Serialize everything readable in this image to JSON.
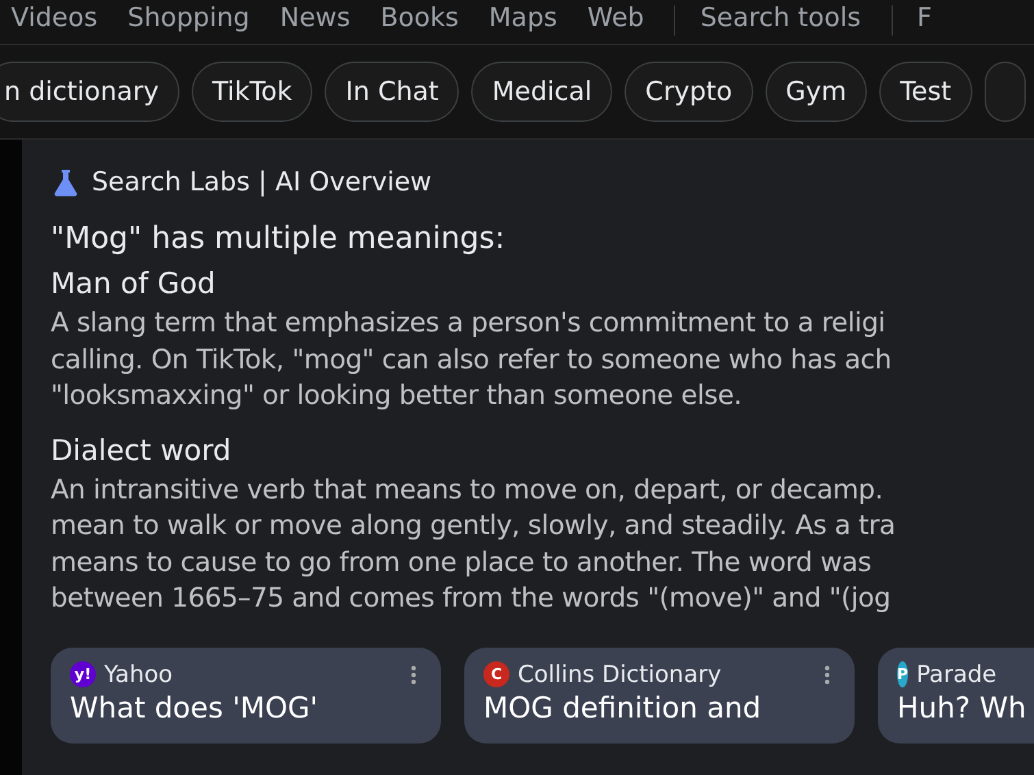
{
  "nav_tabs": [
    {
      "label": "Videos"
    },
    {
      "label": "Shopping"
    },
    {
      "label": "News"
    },
    {
      "label": "Books"
    },
    {
      "label": "Maps"
    },
    {
      "label": "Web"
    },
    {
      "label": "Search tools",
      "kind": "tools"
    },
    {
      "label": "F",
      "kind": "tools"
    }
  ],
  "chips": [
    "n dictionary",
    "TikTok",
    "In Chat",
    "Medical",
    "Crypto",
    "Gym",
    "Test"
  ],
  "overview": {
    "header": "Search Labs | AI Overview",
    "intro": "\"Mog\" has multiple meanings:",
    "sections": [
      {
        "heading": "Man of God",
        "lines": [
          "A slang term that emphasizes a person's commitment to a religi",
          "calling. On TikTok, \"mog\" can also refer to someone who has ach",
          "\"looksmaxxing\" or looking better than someone else."
        ]
      },
      {
        "heading": "Dialect word",
        "lines": [
          "An intransitive verb that means to move on, depart, or decamp.",
          "mean to walk or move along gently, slowly, and steadily. As a tra",
          "means to cause to go from one place to another. The word was",
          "between 1665–75 and comes from the words \"(move)\" and \"(jog"
        ]
      }
    ]
  },
  "sources": [
    {
      "site": "Yahoo",
      "title": "What does 'MOG'",
      "logo": "y!",
      "color": "#6001d2"
    },
    {
      "site": "Collins Dictionary",
      "title": "MOG definition and",
      "logo": "C",
      "color": "#c8281e"
    },
    {
      "site": "Parade",
      "title": "Huh? Wh",
      "logo": "P",
      "color": "#29a9c9"
    }
  ]
}
